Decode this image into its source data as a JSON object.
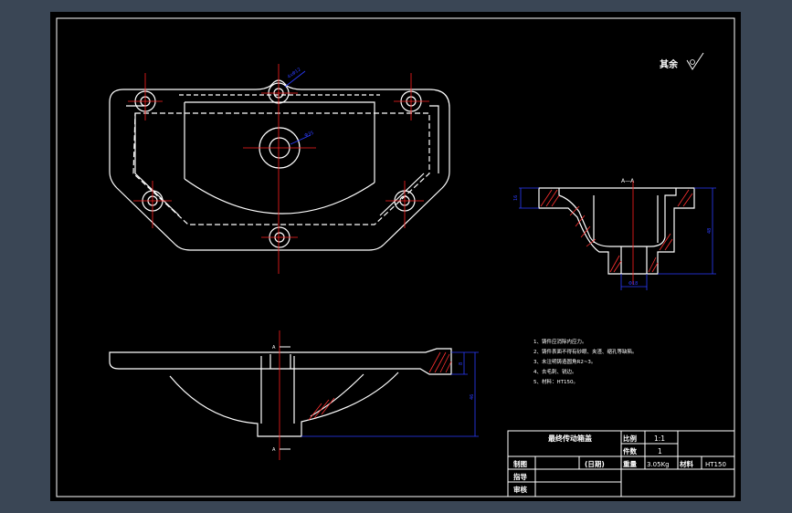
{
  "colors": {
    "background": "#3a4655",
    "sheet": "#000000",
    "outline": "#ffffff",
    "centerline": "#ff2020",
    "dimension": "#2b3cff",
    "hatch": "#ff3030"
  },
  "roughness_label": "其余",
  "section_label": "A—A",
  "notes": [
    "1、铸件应消除内应力。",
    "2、铸件表面不得有砂眼、夹渣、缩孔等缺陷。",
    "3、未注明铸造圆角R2~3。",
    "4、去毛刺、锐边。",
    "5、材料：HT150。"
  ],
  "title_block": {
    "part_name": "最终传动箱盖",
    "scale_label": "比例",
    "scale_value": "1:1",
    "count_label": "件数",
    "count_value": "1",
    "drawn_label": "制图",
    "date_label": "(日期)",
    "weight_label": "重量",
    "weight_value": "3.05Kg",
    "material_label": "材料",
    "material_value": "HT150",
    "guide_label": "指导",
    "review_label": "审核"
  },
  "dimensions": {
    "top_hole": "4xΦ12",
    "center_hole": "Φ35",
    "section_height_small": "16",
    "section_height": "48",
    "section_bottom": "Φ18",
    "front_height": "46",
    "front_small": "8"
  },
  "view_markers": {
    "section_top": "A",
    "section_bottom": "A"
  }
}
